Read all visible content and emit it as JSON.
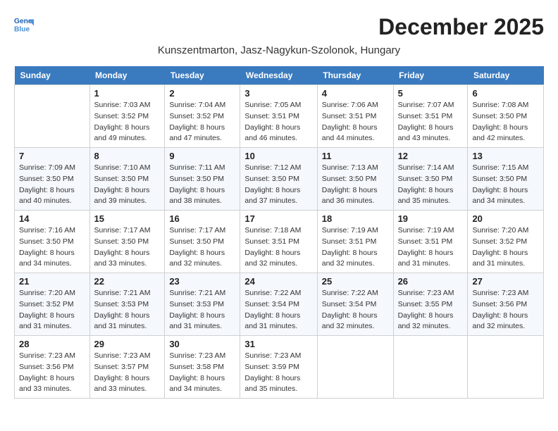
{
  "logo": {
    "line1": "General",
    "line2": "Blue"
  },
  "title": "December 2025",
  "subtitle": "Kunszentmarton, Jasz-Nagykun-Szolonok, Hungary",
  "weekdays": [
    "Sunday",
    "Monday",
    "Tuesday",
    "Wednesday",
    "Thursday",
    "Friday",
    "Saturday"
  ],
  "weeks": [
    [
      {
        "day": "",
        "sunrise": "",
        "sunset": "",
        "daylight": ""
      },
      {
        "day": "1",
        "sunrise": "Sunrise: 7:03 AM",
        "sunset": "Sunset: 3:52 PM",
        "daylight": "Daylight: 8 hours and 49 minutes."
      },
      {
        "day": "2",
        "sunrise": "Sunrise: 7:04 AM",
        "sunset": "Sunset: 3:52 PM",
        "daylight": "Daylight: 8 hours and 47 minutes."
      },
      {
        "day": "3",
        "sunrise": "Sunrise: 7:05 AM",
        "sunset": "Sunset: 3:51 PM",
        "daylight": "Daylight: 8 hours and 46 minutes."
      },
      {
        "day": "4",
        "sunrise": "Sunrise: 7:06 AM",
        "sunset": "Sunset: 3:51 PM",
        "daylight": "Daylight: 8 hours and 44 minutes."
      },
      {
        "day": "5",
        "sunrise": "Sunrise: 7:07 AM",
        "sunset": "Sunset: 3:51 PM",
        "daylight": "Daylight: 8 hours and 43 minutes."
      },
      {
        "day": "6",
        "sunrise": "Sunrise: 7:08 AM",
        "sunset": "Sunset: 3:50 PM",
        "daylight": "Daylight: 8 hours and 42 minutes."
      }
    ],
    [
      {
        "day": "7",
        "sunrise": "Sunrise: 7:09 AM",
        "sunset": "Sunset: 3:50 PM",
        "daylight": "Daylight: 8 hours and 40 minutes."
      },
      {
        "day": "8",
        "sunrise": "Sunrise: 7:10 AM",
        "sunset": "Sunset: 3:50 PM",
        "daylight": "Daylight: 8 hours and 39 minutes."
      },
      {
        "day": "9",
        "sunrise": "Sunrise: 7:11 AM",
        "sunset": "Sunset: 3:50 PM",
        "daylight": "Daylight: 8 hours and 38 minutes."
      },
      {
        "day": "10",
        "sunrise": "Sunrise: 7:12 AM",
        "sunset": "Sunset: 3:50 PM",
        "daylight": "Daylight: 8 hours and 37 minutes."
      },
      {
        "day": "11",
        "sunrise": "Sunrise: 7:13 AM",
        "sunset": "Sunset: 3:50 PM",
        "daylight": "Daylight: 8 hours and 36 minutes."
      },
      {
        "day": "12",
        "sunrise": "Sunrise: 7:14 AM",
        "sunset": "Sunset: 3:50 PM",
        "daylight": "Daylight: 8 hours and 35 minutes."
      },
      {
        "day": "13",
        "sunrise": "Sunrise: 7:15 AM",
        "sunset": "Sunset: 3:50 PM",
        "daylight": "Daylight: 8 hours and 34 minutes."
      }
    ],
    [
      {
        "day": "14",
        "sunrise": "Sunrise: 7:16 AM",
        "sunset": "Sunset: 3:50 PM",
        "daylight": "Daylight: 8 hours and 34 minutes."
      },
      {
        "day": "15",
        "sunrise": "Sunrise: 7:17 AM",
        "sunset": "Sunset: 3:50 PM",
        "daylight": "Daylight: 8 hours and 33 minutes."
      },
      {
        "day": "16",
        "sunrise": "Sunrise: 7:17 AM",
        "sunset": "Sunset: 3:50 PM",
        "daylight": "Daylight: 8 hours and 32 minutes."
      },
      {
        "day": "17",
        "sunrise": "Sunrise: 7:18 AM",
        "sunset": "Sunset: 3:51 PM",
        "daylight": "Daylight: 8 hours and 32 minutes."
      },
      {
        "day": "18",
        "sunrise": "Sunrise: 7:19 AM",
        "sunset": "Sunset: 3:51 PM",
        "daylight": "Daylight: 8 hours and 32 minutes."
      },
      {
        "day": "19",
        "sunrise": "Sunrise: 7:19 AM",
        "sunset": "Sunset: 3:51 PM",
        "daylight": "Daylight: 8 hours and 31 minutes."
      },
      {
        "day": "20",
        "sunrise": "Sunrise: 7:20 AM",
        "sunset": "Sunset: 3:52 PM",
        "daylight": "Daylight: 8 hours and 31 minutes."
      }
    ],
    [
      {
        "day": "21",
        "sunrise": "Sunrise: 7:20 AM",
        "sunset": "Sunset: 3:52 PM",
        "daylight": "Daylight: 8 hours and 31 minutes."
      },
      {
        "day": "22",
        "sunrise": "Sunrise: 7:21 AM",
        "sunset": "Sunset: 3:53 PM",
        "daylight": "Daylight: 8 hours and 31 minutes."
      },
      {
        "day": "23",
        "sunrise": "Sunrise: 7:21 AM",
        "sunset": "Sunset: 3:53 PM",
        "daylight": "Daylight: 8 hours and 31 minutes."
      },
      {
        "day": "24",
        "sunrise": "Sunrise: 7:22 AM",
        "sunset": "Sunset: 3:54 PM",
        "daylight": "Daylight: 8 hours and 31 minutes."
      },
      {
        "day": "25",
        "sunrise": "Sunrise: 7:22 AM",
        "sunset": "Sunset: 3:54 PM",
        "daylight": "Daylight: 8 hours and 32 minutes."
      },
      {
        "day": "26",
        "sunrise": "Sunrise: 7:23 AM",
        "sunset": "Sunset: 3:55 PM",
        "daylight": "Daylight: 8 hours and 32 minutes."
      },
      {
        "day": "27",
        "sunrise": "Sunrise: 7:23 AM",
        "sunset": "Sunset: 3:56 PM",
        "daylight": "Daylight: 8 hours and 32 minutes."
      }
    ],
    [
      {
        "day": "28",
        "sunrise": "Sunrise: 7:23 AM",
        "sunset": "Sunset: 3:56 PM",
        "daylight": "Daylight: 8 hours and 33 minutes."
      },
      {
        "day": "29",
        "sunrise": "Sunrise: 7:23 AM",
        "sunset": "Sunset: 3:57 PM",
        "daylight": "Daylight: 8 hours and 33 minutes."
      },
      {
        "day": "30",
        "sunrise": "Sunrise: 7:23 AM",
        "sunset": "Sunset: 3:58 PM",
        "daylight": "Daylight: 8 hours and 34 minutes."
      },
      {
        "day": "31",
        "sunrise": "Sunrise: 7:23 AM",
        "sunset": "Sunset: 3:59 PM",
        "daylight": "Daylight: 8 hours and 35 minutes."
      },
      {
        "day": "",
        "sunrise": "",
        "sunset": "",
        "daylight": ""
      },
      {
        "day": "",
        "sunrise": "",
        "sunset": "",
        "daylight": ""
      },
      {
        "day": "",
        "sunrise": "",
        "sunset": "",
        "daylight": ""
      }
    ]
  ]
}
